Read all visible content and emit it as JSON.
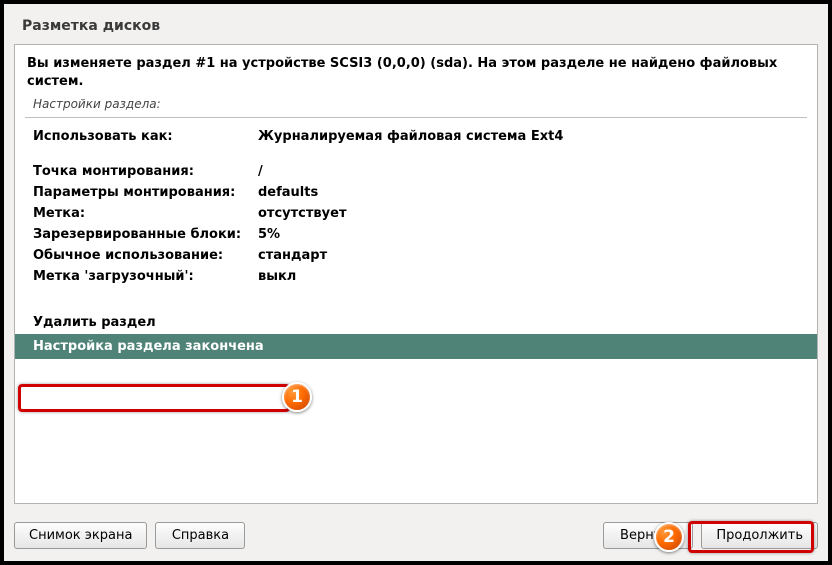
{
  "title": "Разметка дисков",
  "intro": "Вы изменяете раздел #1 на устройстве SCSI3 (0,0,0) (sda). На этом разделе не найдено файловых систем.",
  "subtitle": "Настройки раздела:",
  "settings": [
    {
      "label": "Использовать как:",
      "value": "Журналируемая файловая система Ext4",
      "gap_after": true
    },
    {
      "label": "Точка монтирования:",
      "value": "/"
    },
    {
      "label": "Параметры монтирования:",
      "value": "defaults"
    },
    {
      "label": "Метка:",
      "value": "отсутствует"
    },
    {
      "label": "Зарезервированные блоки:",
      "value": "5%"
    },
    {
      "label": "Обычное использование:",
      "value": "стандарт"
    },
    {
      "label": "Метка 'загрузочный':",
      "value": "выкл",
      "gap_after": true
    }
  ],
  "actions": {
    "delete": "Удалить раздел",
    "done": "Настройка раздела закончена"
  },
  "buttons": {
    "screenshot": "Снимок экрана",
    "help": "Справка",
    "back": "Вернуть",
    "continue": "Продолжить"
  },
  "callouts": {
    "one": "1",
    "two": "2"
  }
}
